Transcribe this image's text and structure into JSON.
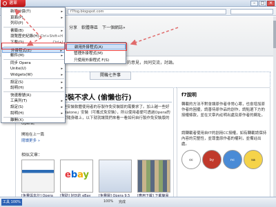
{
  "titlebar": {
    "app_button_label": "選單",
    "window_controls": [
      "–",
      "□",
      "✕"
    ]
  },
  "addressbar": {
    "url": "f7fog.blogspot.com",
    "search_placeholder": ""
  },
  "site": {
    "nav": [
      "分享",
      "軟體專區",
      "下一個網誌»"
    ],
    "tagline": "的意見，共同交流，討論。",
    "category_tab": "開機七件事"
  },
  "article": {
    "title": "免安裝不求人 (偷懶也行)",
    "p1": "相信許多人都有這種困擾是安裝軟體使用者的存製作免安裝版的需要求了。加上越一些好用的免安裝版軟體「Standalone」安裝（可攜式免安裝），所以使用者便可透過Opera的可攜式版來自行加以安裝於隨身碟上，以下就就讓我們來看一看如何自行製作免安裝版的Opera。",
    "p2": "開始在上一篇",
    "p3": "閱讀更多 »",
    "related_label": "相似文章：",
    "related": [
      {
        "caption": "[免費與本計] Opera 9.62 發佈主要"
      },
      {
        "caption": "[幫助] 好玩的 eBay 圖片"
      },
      {
        "caption": "[免費圖] Opera 9.5 已經發佈（測試版"
      },
      {
        "caption": "[應用下載] 下載簡易 BY 數的顯示"
      }
    ]
  },
  "sidebar": {
    "title": "f7說明",
    "p1": "轉載的方法不對會讓原作者非常心寒，也會增加原作者的困擾，請善待原作品的創作，請點選下方的授權條款，並在文章內註明出處及原作者的網址。",
    "p2": "請轉載者使用自f7的創用CC授權，如有轉載請保持內容的完整性，並尊重原作者的權利，並備註出處。",
    "cc_icons": [
      "cc",
      "by",
      "nc",
      "sa"
    ]
  },
  "main_menu": {
    "items": [
      {
        "label": "新增分頁(T)",
        "shortcut": "",
        "submenu": true
      },
      {
        "label": "頁面(P)",
        "shortcut": "",
        "submenu": true
      },
      {
        "label": "列印(P)",
        "shortcut": "",
        "submenu": false
      },
      {
        "label": "書籤(B)",
        "shortcut": "",
        "submenu": true
      },
      {
        "label": "瀏覽歷史紀錄(H)",
        "shortcut": "Ctrl+Shift+H",
        "submenu": false
      },
      {
        "label": "下載(D)",
        "shortcut": "Ctrl+J",
        "submenu": false
      },
      {
        "label": "外掛程式(E)",
        "shortcut": "",
        "submenu": true
      },
      {
        "label": "郵件(M)",
        "shortcut": "",
        "submenu": true
      },
      {
        "label": "同步 Opera",
        "shortcut": "",
        "submenu": false
      },
      {
        "label": "Unite(U)",
        "shortcut": "",
        "submenu": true
      },
      {
        "label": "Widgets(W)",
        "shortcut": "",
        "submenu": true
      },
      {
        "label": "設定(S)",
        "shortcut": "",
        "submenu": true
      },
      {
        "label": "說明(H)",
        "shortcut": "",
        "submenu": true
      },
      {
        "label": "快速撥號(R)",
        "shortcut": "",
        "submenu": false
      },
      {
        "label": "工具列(T)",
        "shortcut": "",
        "submenu": true
      },
      {
        "label": "設定(S)",
        "shortcut": "",
        "submenu": true
      },
      {
        "label": "說明(H)",
        "shortcut": "",
        "submenu": true
      },
      {
        "label": "離開(X)",
        "shortcut": "",
        "submenu": false
      }
    ]
  },
  "submenu": {
    "items": [
      {
        "label": "啟用外掛程式(A)"
      },
      {
        "label": "管理外掛程式(M)"
      },
      {
        "label": "只使用外掛程式 F(S)"
      }
    ]
  },
  "statusbar": {
    "button_label": "工具 100%",
    "zoom": "100%",
    "status": "完成"
  }
}
